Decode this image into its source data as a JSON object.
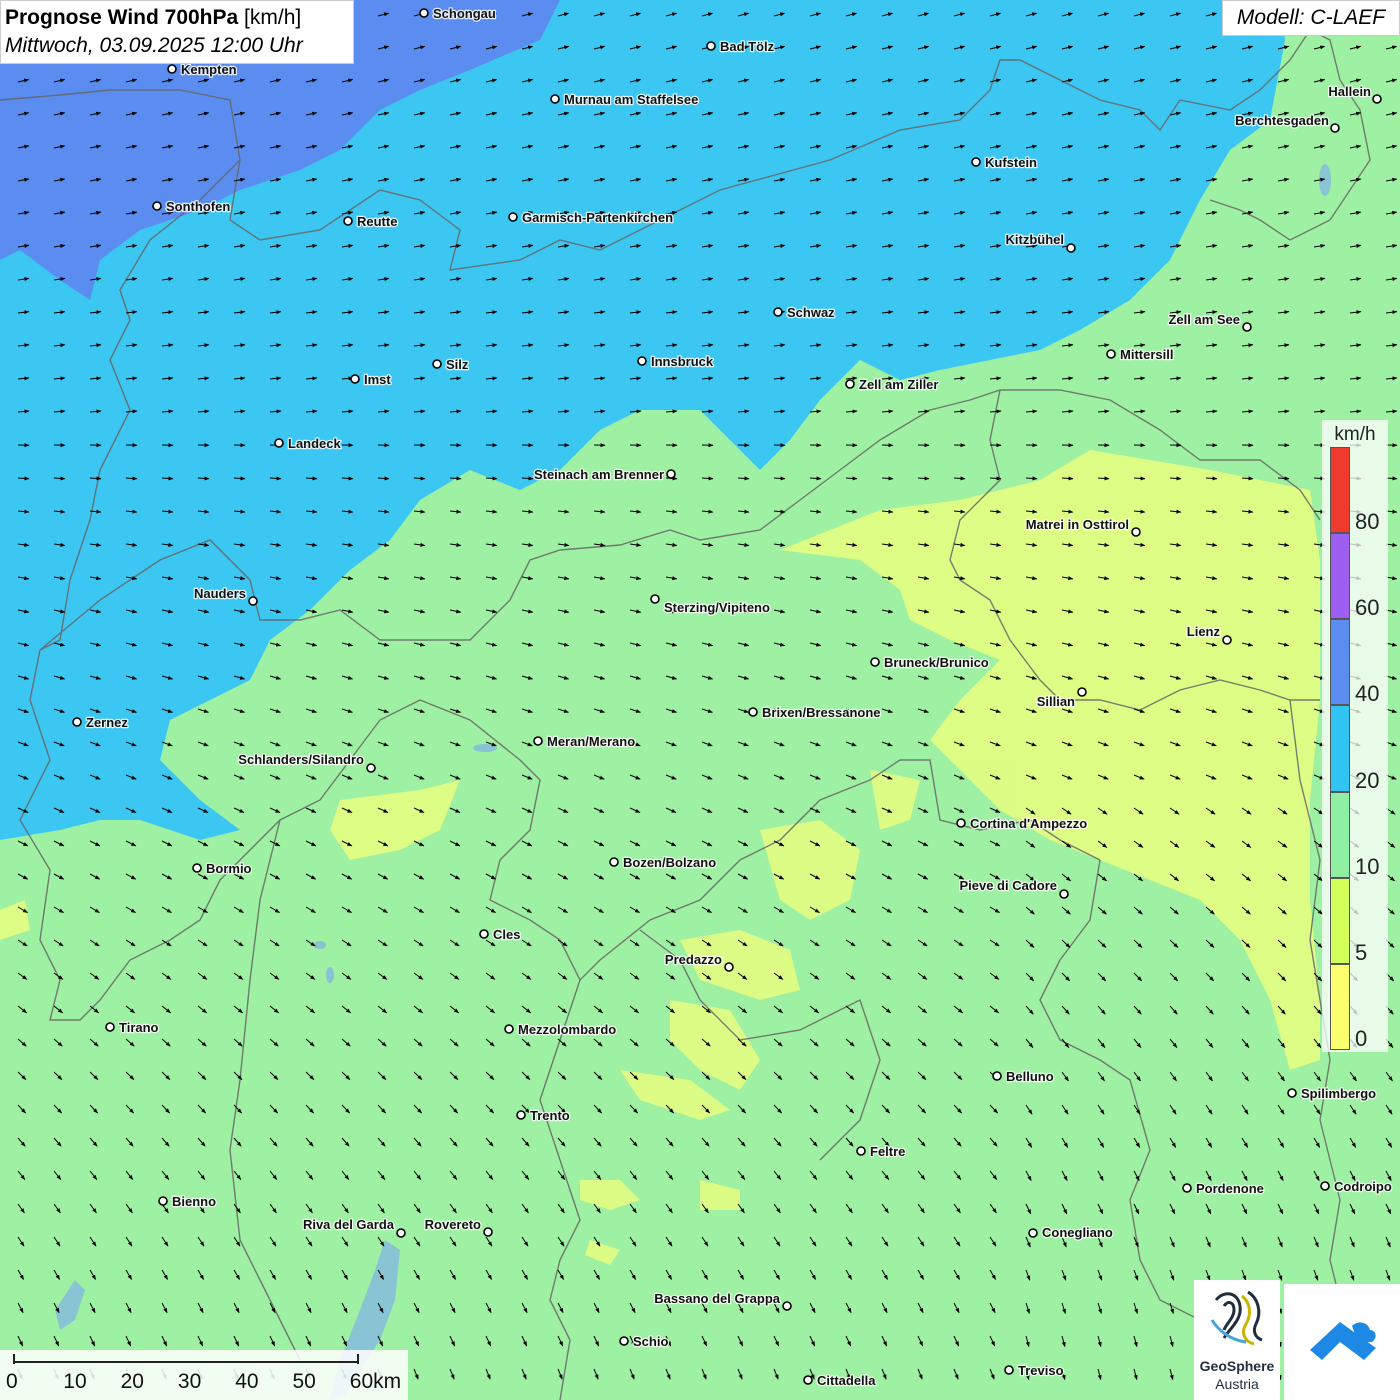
{
  "title": {
    "bold": "Prognose Wind 700hPa",
    "unit": "[km/h]",
    "date": "Mittwoch, 03.09.2025 12:00 Uhr"
  },
  "model": "Modell: C-LAEF",
  "legend": {
    "unit": "km/h",
    "ticks": [
      "0",
      "5",
      "10",
      "20",
      "40",
      "60",
      "80"
    ],
    "colors": [
      "#fbff6e",
      "#d2ff58",
      "#8ff0a4",
      "#2fc4f4",
      "#5b8df0",
      "#9d5ff0",
      "#f03a2e"
    ]
  },
  "scalebar": {
    "ticks": [
      "0",
      "10",
      "20",
      "30",
      "40",
      "50",
      "60km"
    ]
  },
  "logo": {
    "line1": "GeoSphere",
    "line2": "Austria"
  },
  "colors": {
    "wind_0_5": "#f2ff7a",
    "wind_5_10": "#9ef0a2",
    "wind_10_20": "#3cc6f2",
    "wind_20_40": "#5b8df0",
    "border": "#666666",
    "brand_blue": "#1e88e5"
  },
  "cities": [
    {
      "name": "Schongau"
    },
    {
      "name": "Bad Tölz"
    },
    {
      "name": "Kempten"
    },
    {
      "name": "Murnau am Staffelsee"
    },
    {
      "name": "Hallein"
    },
    {
      "name": "Berchtesgaden"
    },
    {
      "name": "Kufstein"
    },
    {
      "name": "Sonthofen"
    },
    {
      "name": "Reutte"
    },
    {
      "name": "Garmisch-Partenkirchen"
    },
    {
      "name": "Kitzbühel"
    },
    {
      "name": "Schwaz"
    },
    {
      "name": "Zell am See"
    },
    {
      "name": "Mittersill"
    },
    {
      "name": "Innsbruck"
    },
    {
      "name": "Silz"
    },
    {
      "name": "Imst"
    },
    {
      "name": "Zell am Ziller"
    },
    {
      "name": "Landeck"
    },
    {
      "name": "Steinach am Brenner"
    },
    {
      "name": "Matrei in Osttirol"
    },
    {
      "name": "Nauders"
    },
    {
      "name": "Sterzing/Vipiteno"
    },
    {
      "name": "Lienz"
    },
    {
      "name": "Bruneck/Brunico"
    },
    {
      "name": "Sillian"
    },
    {
      "name": "Brixen/Bressanone"
    },
    {
      "name": "Zernez"
    },
    {
      "name": "Meran/Merano"
    },
    {
      "name": "Schlanders/Silandro"
    },
    {
      "name": "Cortina d'Ampezzo"
    },
    {
      "name": "Bozen/Bolzano"
    },
    {
      "name": "Bormio"
    },
    {
      "name": "Pieve di Cadore"
    },
    {
      "name": "Cles"
    },
    {
      "name": "Predazzo"
    },
    {
      "name": "Tirano"
    },
    {
      "name": "Mezzolombardo"
    },
    {
      "name": "Belluno"
    },
    {
      "name": "Spilimbergo"
    },
    {
      "name": "Trento"
    },
    {
      "name": "Feltre"
    },
    {
      "name": "Pordenone"
    },
    {
      "name": "Codroipo"
    },
    {
      "name": "Bienno"
    },
    {
      "name": "Riva del Garda"
    },
    {
      "name": "Rovereto"
    },
    {
      "name": "Conegliano"
    },
    {
      "name": "Bassano del Grappa"
    },
    {
      "name": "Schio"
    },
    {
      "name": "Treviso"
    },
    {
      "name": "Cittadella"
    }
  ]
}
